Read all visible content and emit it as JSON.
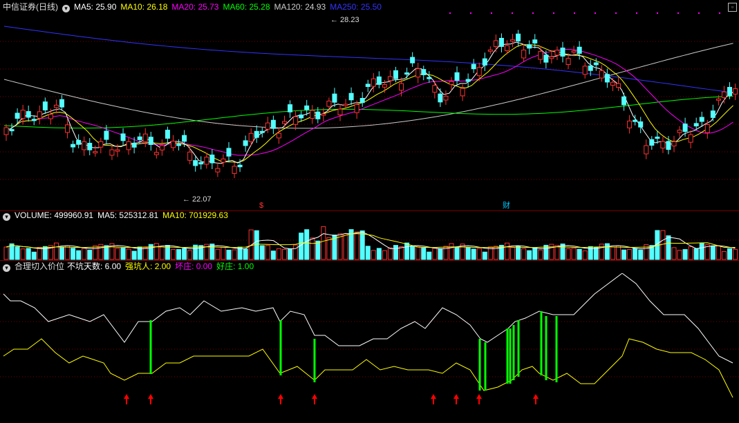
{
  "price_panel": {
    "title": "中信证券(日线)",
    "toggle_icon": "chevron-down-icon",
    "max_button_icon": "square-icon",
    "indicators": [
      {
        "label": "MA5: 25.90",
        "color": "#ffffff"
      },
      {
        "label": "MA10: 26.18",
        "color": "#ffff00"
      },
      {
        "label": "MA20: 25.73",
        "color": "#ff00ff"
      },
      {
        "label": "MA60: 25.28",
        "color": "#00ff00"
      },
      {
        "label": "MA120: 24.93",
        "color": "#cccccc"
      },
      {
        "label": "MA250: 25.50",
        "color": "#3333ff"
      }
    ],
    "high_label": "28.23",
    "low_label": "22.07",
    "markers": [
      {
        "text": "$",
        "color": "#ff3333"
      },
      {
        "text": "财",
        "color": "#00c8ff"
      }
    ]
  },
  "volume_panel": {
    "toggle_icon": "chevron-down-icon",
    "indicators": [
      {
        "label": "VOLUME: 499960.91",
        "color": "#ffffff"
      },
      {
        "label": "MA5: 525312.81",
        "color": "#ffffff"
      },
      {
        "label": "MA10: 701929.63",
        "color": "#ffff00"
      }
    ]
  },
  "indicator_panel": {
    "toggle_icon": "chevron-down-icon",
    "title": "合理切入价位",
    "indicators": [
      {
        "label": "不坑天数: 6.00",
        "color": "#ffffff"
      },
      {
        "label": "强坑人: 2.00",
        "color": "#ffff00"
      },
      {
        "label": "坏庄: 0.00",
        "color": "#ff00ff"
      },
      {
        "label": "好庄: 1.00",
        "color": "#00ff00"
      }
    ],
    "signal_icon": "red-up-arrow-icon"
  },
  "colors": {
    "up": "#ff3232",
    "down": "#54ffff",
    "ma5": "#ffffff",
    "ma10": "#ffff00",
    "ma20": "#ff00ff",
    "ma60": "#00ff00",
    "ma120": "#cccccc",
    "ma250": "#3333ff",
    "grid": "#7a0000",
    "signal_bar": "#00ff00",
    "arrow": "#ff0000"
  }
}
